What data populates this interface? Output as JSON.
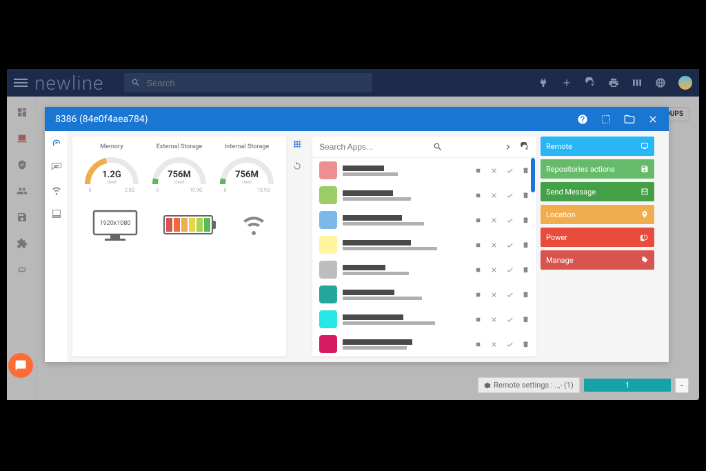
{
  "brand": "newline",
  "search": {
    "placeholder": "Search"
  },
  "groups_btn": "OUPS",
  "modal": {
    "title": "8386 (84e0f4aea784)",
    "gauges": [
      {
        "title": "Memory",
        "value": "1.2G",
        "min": "0",
        "max": "2.8G",
        "used_label": "Used",
        "color": "#f0ad4e",
        "pct": 0.43
      },
      {
        "title": "External Storage",
        "value": "756M",
        "min": "0",
        "max": "10.9G",
        "used_label": "Used",
        "color": "#5cb85c",
        "pct": 0.07
      },
      {
        "title": "Internal Storage",
        "value": "756M",
        "min": "0",
        "max": "10.9G",
        "used_label": "Used",
        "color": "#5cb85c",
        "pct": 0.07
      }
    ],
    "resolution": "1920x1080",
    "battery_cells": [
      "#d9534f",
      "#f0693c",
      "#f0ad4e",
      "#e6d54a",
      "#a6d64a",
      "#5cb85c"
    ],
    "apps_search_placeholder": "Search Apps...",
    "swatches": [
      "#ef8e8e",
      "#9ccc65",
      "#7cb8e8",
      "#fff59d",
      "#bdbdbd",
      "#26a69a",
      "#26e6e6",
      "#d81b60"
    ],
    "actions": [
      {
        "label": "Remote",
        "color": "#29b6f6",
        "icon": "monitor"
      },
      {
        "label": "Repositories actions",
        "color": "#66bb6a",
        "icon": "save"
      },
      {
        "label": "Send Message",
        "color": "#43a047",
        "icon": "mail"
      },
      {
        "label": "Location",
        "color": "#f0ad4e",
        "icon": "pin"
      },
      {
        "label": "Power",
        "color": "#e74c3c",
        "icon": "power"
      },
      {
        "label": "Manage",
        "color": "#d9534f",
        "icon": "tag"
      }
    ]
  },
  "bottom": {
    "label": "Remote settings : ..,- (1)",
    "badge": "1"
  }
}
